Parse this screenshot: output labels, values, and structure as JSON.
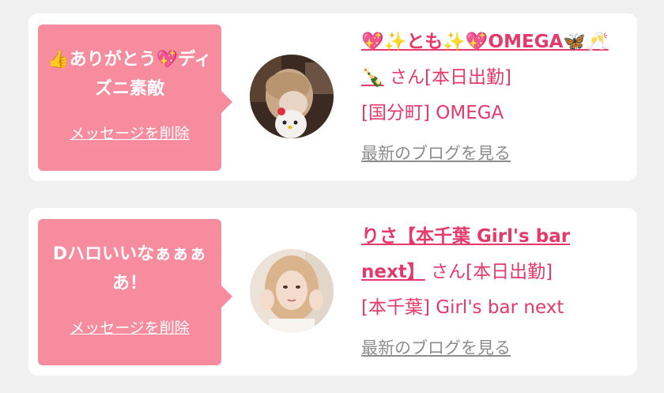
{
  "cards": [
    {
      "message": "👍ありがとう💖ディズニ素敵",
      "delete_label": "メッセージを削除",
      "name": "💖✨とも✨💖OMEGA🦋🥂🍾",
      "san": "さん",
      "status": "[本日出勤]",
      "area": "[国分町] OMEGA",
      "blog_label": "最新のブログを見る"
    },
    {
      "message": "Dハロいいなぁぁぁあ！",
      "delete_label": "メッセージを削除",
      "name": "りさ【本千葉 Girl's bar next】",
      "san": "さん",
      "status": "[本日出勤]",
      "area": "[本千葉] Girl's bar next",
      "blog_label": "最新のブログを見る"
    }
  ],
  "colors": {
    "bubble": "#f68c9d",
    "name": "#e5396a",
    "link_gray": "#8c8c8c",
    "background": "#f0f0f0"
  }
}
